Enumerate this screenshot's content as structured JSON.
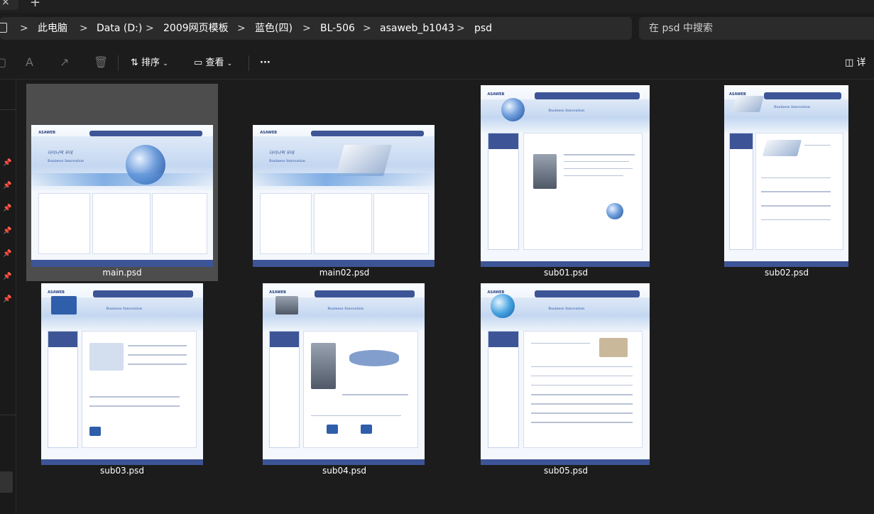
{
  "titlebar": {
    "close_glyph": "×",
    "new_tab_glyph": "+"
  },
  "address": {
    "crumbs": [
      "此电脑",
      "Data (D:)",
      "2009网页模板",
      "蓝色(四)",
      "BL-506",
      "asaweb_b1043",
      "psd"
    ],
    "separator": ">"
  },
  "search": {
    "placeholder": "在 psd 中搜索"
  },
  "toolbar": {
    "sort_label": "排序",
    "view_label": "查看",
    "more_label": "···",
    "details_label": "详"
  },
  "files": [
    {
      "name": "main.psd",
      "kind": "main",
      "selected": true
    },
    {
      "name": "main02.psd",
      "kind": "main02",
      "selected": false
    },
    {
      "name": "sub01.psd",
      "kind": "sub",
      "selected": false
    },
    {
      "name": "sub02.psd",
      "kind": "sub",
      "selected": false
    },
    {
      "name": "sub03.psd",
      "kind": "sub",
      "selected": false
    },
    {
      "name": "sub04.psd",
      "kind": "sub",
      "selected": false
    },
    {
      "name": "sub05.psd",
      "kind": "sub",
      "selected": false
    }
  ],
  "thumb_text": {
    "logo": "ASAWEB",
    "script": "다이나믹 무대",
    "tagline": "Business Innovation"
  },
  "colors": {
    "background": "#1c1c1c",
    "selection": "#4d4d4d",
    "accent_navy": "#3d5596"
  }
}
